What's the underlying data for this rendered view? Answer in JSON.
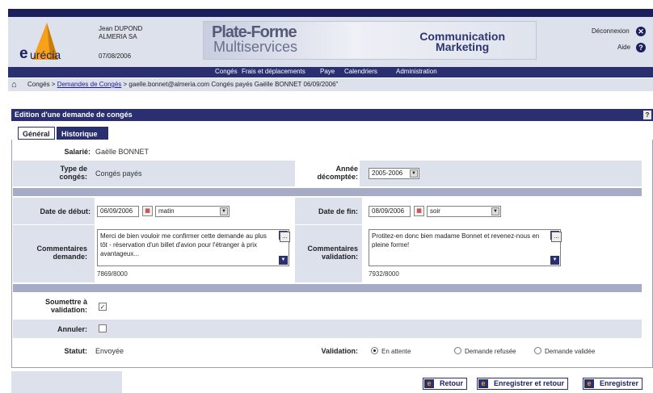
{
  "header": {
    "brand": "urécia",
    "brand_initial": "e",
    "user_name": "Jean DUPOND",
    "company": "ALMERIA SA",
    "date": "07/08/2006",
    "banner_line1": "Plate-Forme",
    "banner_line2": "Multiservices",
    "banner_right_1": "Communication",
    "banner_right_2": "Marketing",
    "logout": "Déconnexion",
    "help": "Aide"
  },
  "menu": {
    "items": [
      "Congés",
      "Frais et déplacements",
      "Paye",
      "Calendriers",
      "Administration"
    ]
  },
  "breadcrumb": {
    "part1": "Congés > ",
    "link": "Demandes de Congés",
    "part2": " > gaelle.bonnet@almeria.com Congés payés Gaëlle BONNET 06/09/2006\""
  },
  "panel": {
    "title": "Edition d'une demande de congés",
    "help": "?"
  },
  "tabs": [
    "Général",
    "Historique"
  ],
  "form": {
    "salarie_label": "Salarié:",
    "salarie_value": "Gaëlle BONNET",
    "type_label_1": "Type de",
    "type_label_2": "congés:",
    "type_value": "Congés payés",
    "annee_label_1": "Année",
    "annee_label_2": "décomptée:",
    "annee_value": "2005-2006",
    "debut_label": "Date de début:",
    "debut_date": "06/09/2006",
    "debut_period": "matin",
    "fin_label": "Date de fin:",
    "fin_date": "08/09/2006",
    "fin_period": "soir",
    "comm_dem_label_1": "Commentaires",
    "comm_dem_label_2": "demande:",
    "comm_dem_text": "Merci de bien vouloir me confirmer cette demande au plus tôt - réservation d'un billet d'avion pour l'étranger à prix avantageux...",
    "comm_dem_count": "7869/8000",
    "comm_val_label_1": "Commentaires",
    "comm_val_label_2": "validation:",
    "comm_val_text": "Protitez-en donc bien madame Bonnet et revenez-nous en pleine forme!",
    "comm_val_count": "7932/8000",
    "soumettre_label_1": "Soumettre à",
    "soumettre_label_2": "validation:",
    "soumettre_checked": "☑",
    "annuler_label": "Annuler:",
    "statut_label": "Statut:",
    "statut_value": "Envoyée",
    "validation_label": "Validation:",
    "validation_options": [
      "En attente",
      "Demande refusée",
      "Demande validée"
    ]
  },
  "buttons": {
    "retour": "Retour",
    "save_return": "Enregistrer et retour",
    "save": "Enregistrer"
  },
  "colors": {
    "navy": "#2a2f70",
    "shade": "#dde1ec",
    "accent": "#f5a11a"
  }
}
